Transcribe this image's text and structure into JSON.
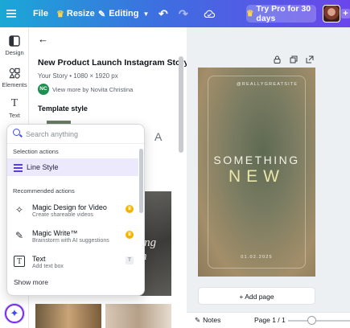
{
  "topbar": {
    "file_label": "File",
    "resize_label": "Resize",
    "mode_label": "Editing",
    "pro_label": "Try Pro for 30 days",
    "plus_label": "+"
  },
  "rail": {
    "items": [
      {
        "label": "Design",
        "icon": "design-icon"
      },
      {
        "label": "Elements",
        "icon": "elements-icon"
      },
      {
        "label": "Text",
        "icon": "text-icon"
      }
    ]
  },
  "panel": {
    "title": "New Product Launch Instagram Story",
    "meta": "Your Story • 1080 × 1920 px",
    "author_initials": "NC",
    "view_more": "View more by Novita Christina",
    "template_style": "Template style",
    "style_glyph": "A"
  },
  "popup": {
    "search_placeholder": "Search anything",
    "selection_header": "Selection actions",
    "selection_item": "Line Style",
    "recommended_header": "Recommended actions",
    "actions": [
      {
        "title": "Magic Design for Video",
        "subtitle": "Create shareable videos",
        "badge": "crown"
      },
      {
        "title": "Magic Write™",
        "subtitle": "Brainstorm with AI suggestions",
        "badge": "crown"
      },
      {
        "title": "Text",
        "subtitle": "Add text box",
        "shortcut": "T"
      }
    ],
    "show_more": "Show more"
  },
  "canvas": {
    "handle": "@REALLYGREATSITE",
    "headline_1": "SOMETHING",
    "headline_2": "NEW",
    "date": "01.02.2025",
    "add_page": "+ Add page"
  },
  "footer": {
    "notes_label": "Notes",
    "page_info": "Page 1 / 1"
  },
  "colors": {
    "accent": "#7d2ae8",
    "selection_bg": "#ede9fd",
    "crown": "#f5b400"
  }
}
